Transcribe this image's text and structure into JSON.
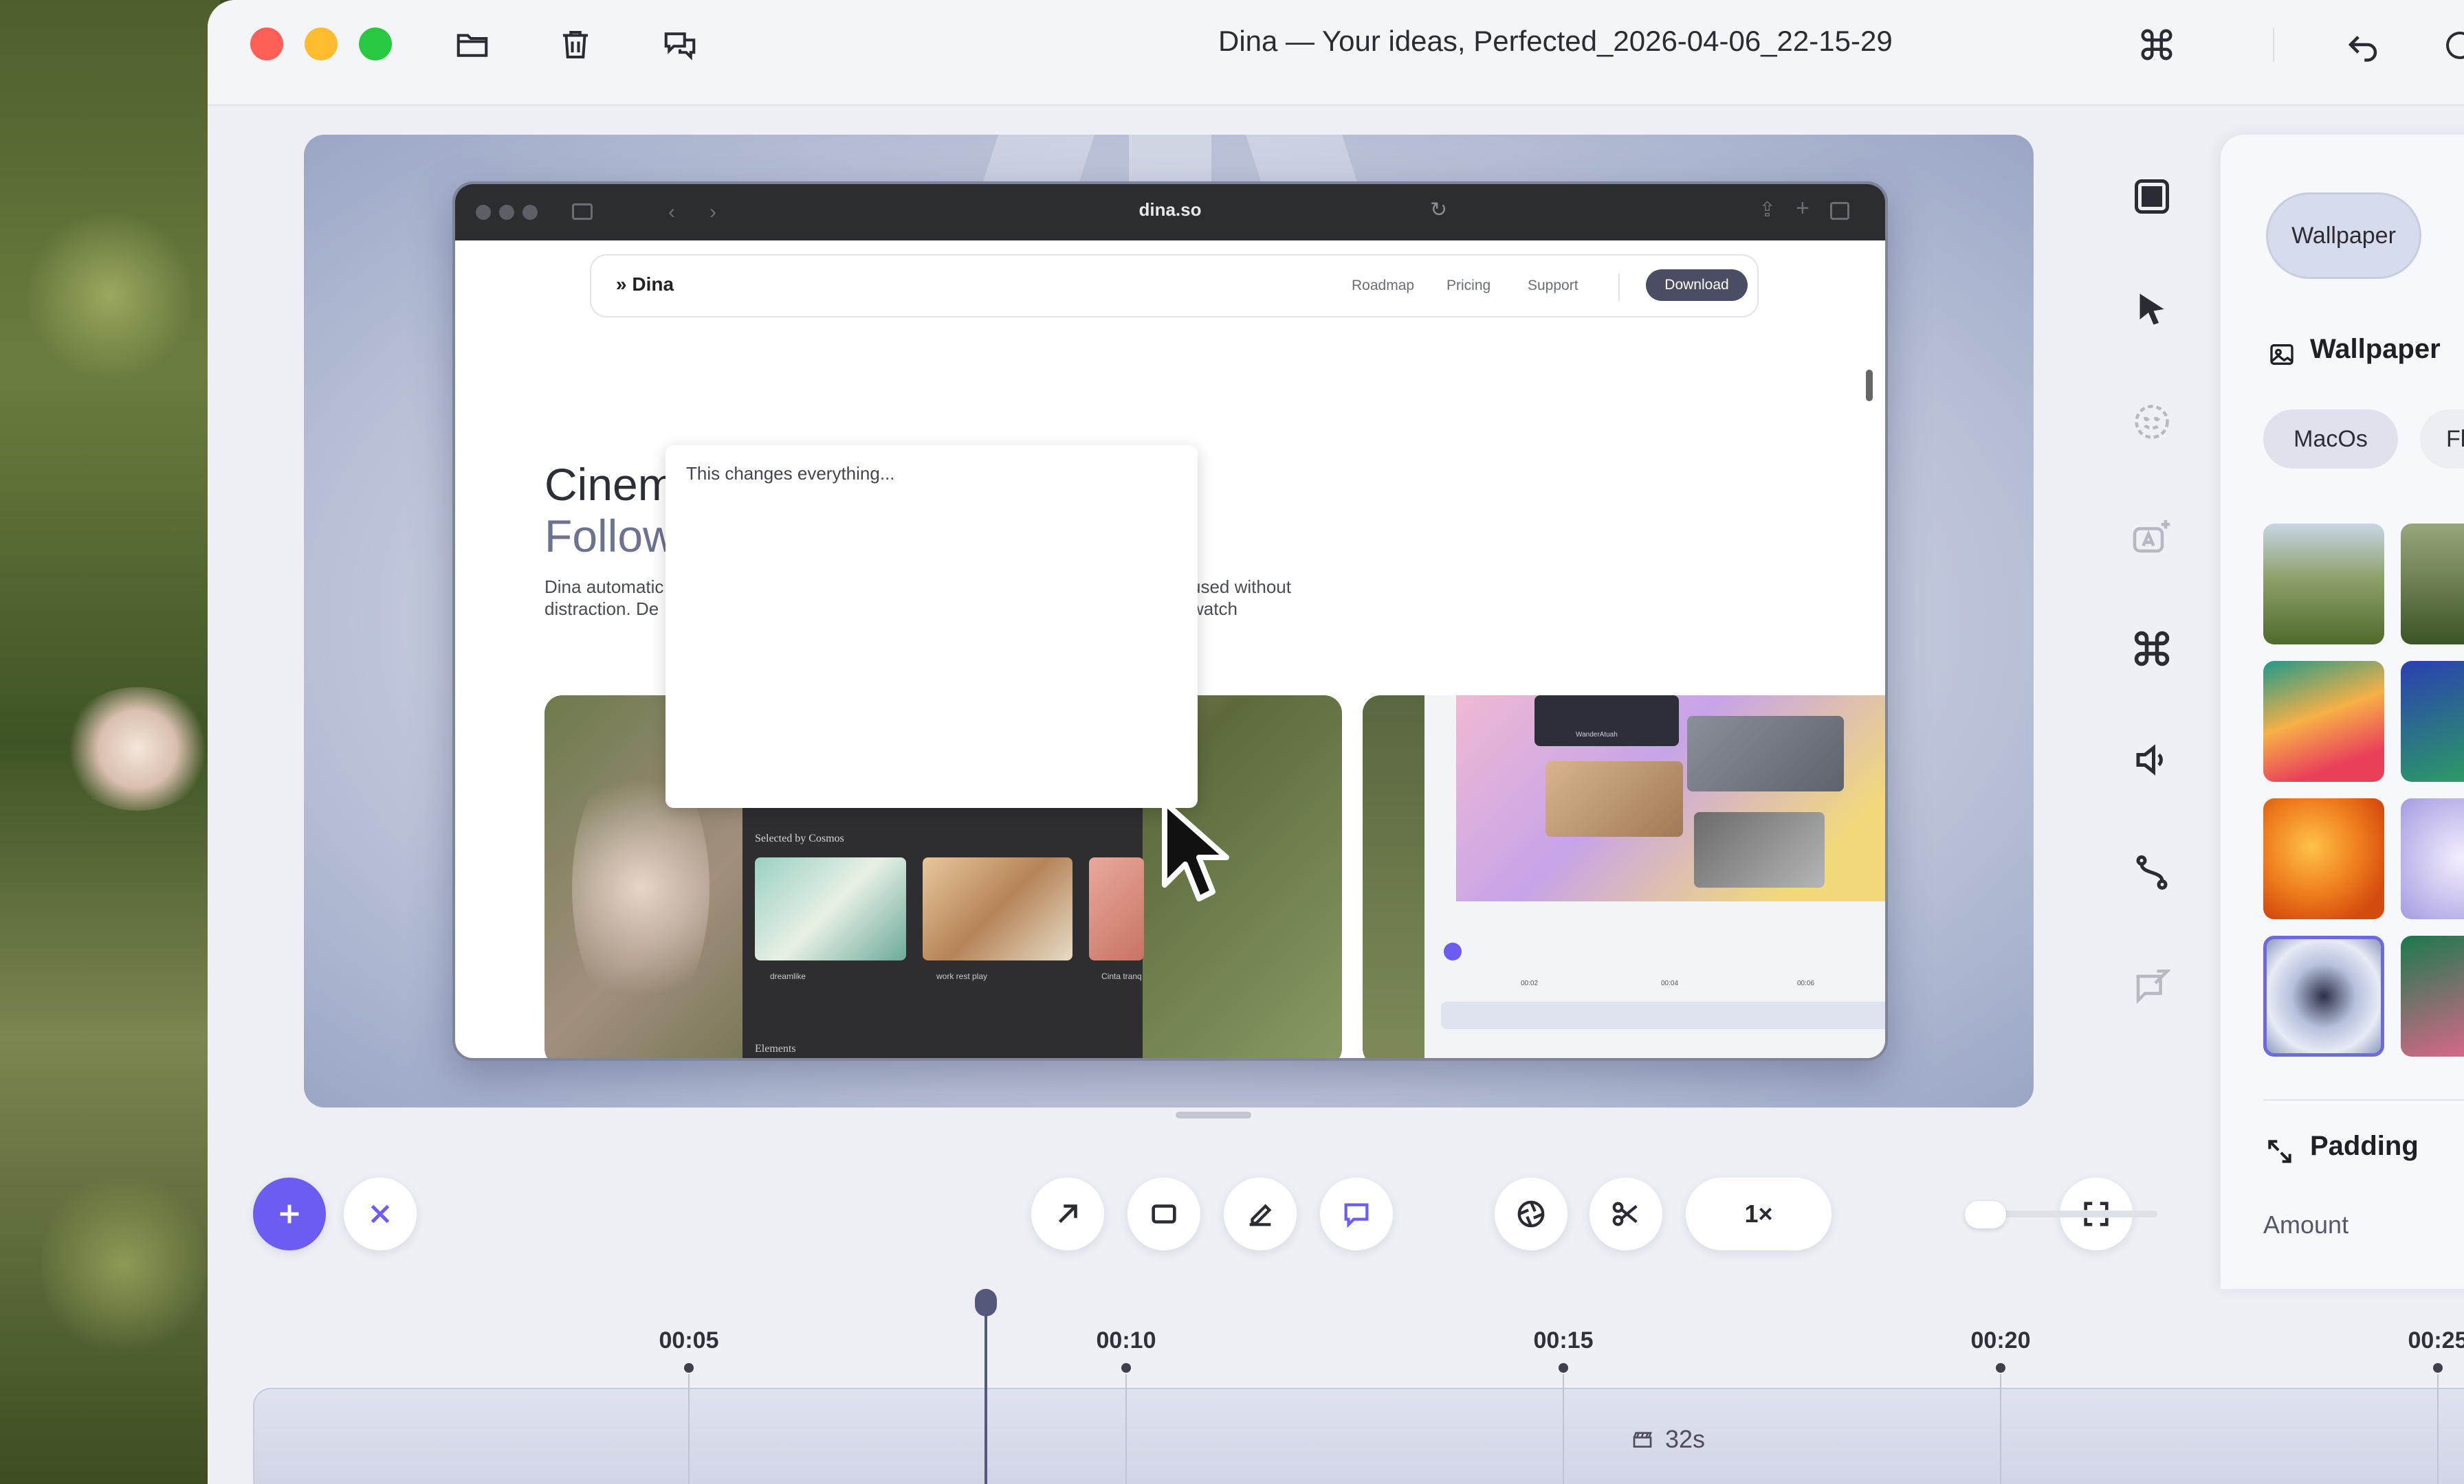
{
  "window": {
    "title": "Dina — Your ideas, Perfected_2026-04-06_22-15-29"
  },
  "colors": {
    "accent": "#6d5cf2",
    "close": "#fe5f57",
    "minimize": "#febc2e",
    "maximize": "#28c840",
    "selected_outline": "#6d6bd8"
  },
  "titlebar_icons": [
    "folder-icon",
    "trash-icon",
    "chat-bubbles-icon",
    "command-icon",
    "undo-icon"
  ],
  "canvas": {
    "browser": {
      "url": "dina.so",
      "brand": "Dina",
      "nav": [
        "Roadmap",
        "Pricing",
        "Support"
      ],
      "download": "Download",
      "hero_line1": "Cinem",
      "hero_line2": "Follow",
      "desc_left_1": "Dina automatic",
      "desc_left_2": "distraction. De",
      "desc_right_1": "used without",
      "desc_right_2": "watch",
      "panel_caption": "Selected by Cosmos",
      "panel_items": [
        "dreamlike",
        "work rest play",
        "Cinta tranq"
      ],
      "panel_footer": "Elements",
      "video_title": "WanderAtuah",
      "timeline_marks": [
        "00:02",
        "00:04",
        "00:06"
      ]
    },
    "note_text": "This changes everything..."
  },
  "rail_icons": [
    "background-frame-icon",
    "cursor-icon",
    "face-icon",
    "text-sparkle-icon",
    "command-icon",
    "volume-icon",
    "path-icon",
    "comment-icon"
  ],
  "right_panel": {
    "tab_label": "Wallpaper",
    "section_title": "Wallpaper",
    "chips": [
      "MacOs",
      "Fl"
    ],
    "padding_title": "Padding",
    "amount_label": "Amount"
  },
  "toolbar": {
    "speed_label": "1×"
  },
  "timeline": {
    "ticks": [
      "00:05",
      "00:10",
      "00:15",
      "00:20",
      "00:25"
    ],
    "duration": "32s"
  }
}
